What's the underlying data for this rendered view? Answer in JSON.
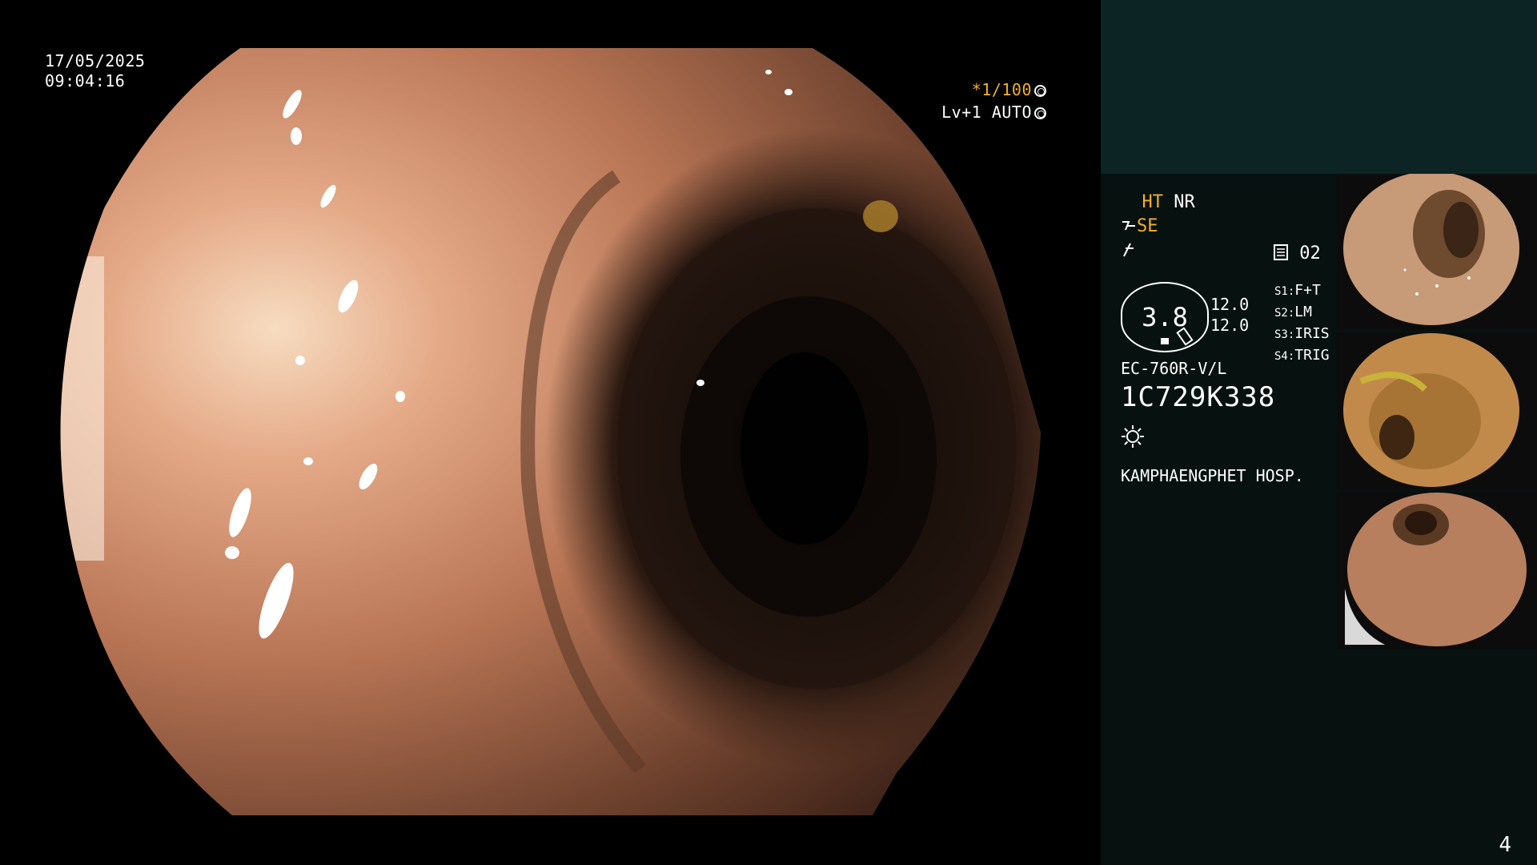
{
  "endoscope_view": {
    "date": "17/05/2025",
    "time": "09:04:16",
    "shutter_prefix": "*",
    "shutter": "1/100",
    "level": "Lv+1",
    "iris_mode": "AUTO"
  },
  "side_panel": {
    "enhancement": "HT",
    "noise_reduction": "NR",
    "color_mode": "SE",
    "page_label": "02",
    "lcd_value": "3.8",
    "iris_value_1": "12.0",
    "iris_value_2": "12.0",
    "switches": [
      {
        "key": "S1:",
        "value": "F+T"
      },
      {
        "key": "S2:",
        "value": "LM"
      },
      {
        "key": "S3:",
        "value": "IRIS"
      },
      {
        "key": "S4:",
        "value": "TRIG"
      }
    ],
    "scope_model": "EC-760R-V/L",
    "scope_serial": "1C729K338",
    "hospital": "KAMPHAENGPHET HOSP."
  },
  "thumbnails": [
    {
      "icon": "endoscopy-thumbnail-1"
    },
    {
      "icon": "endoscopy-thumbnail-2"
    },
    {
      "icon": "endoscopy-thumbnail-3"
    }
  ],
  "footer": {
    "page_number": "4"
  },
  "colors": {
    "accent_amber": "#f3b02a",
    "panel_bg": "#071110",
    "panel_top_bg": "#0d2424",
    "tissue": "#b47a55"
  }
}
